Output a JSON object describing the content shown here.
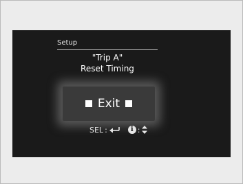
{
  "setup": {
    "header": "Setup",
    "title_line1": "\"Trip A\"",
    "title_line2": "Reset Timing"
  },
  "exit_button": {
    "label": "Exit"
  },
  "hint": {
    "sel_label": "SEL",
    "info_glyph": "i",
    "enter_icon": "enter-arrow-icon",
    "updown_icon": "up-down-arrows-icon"
  }
}
